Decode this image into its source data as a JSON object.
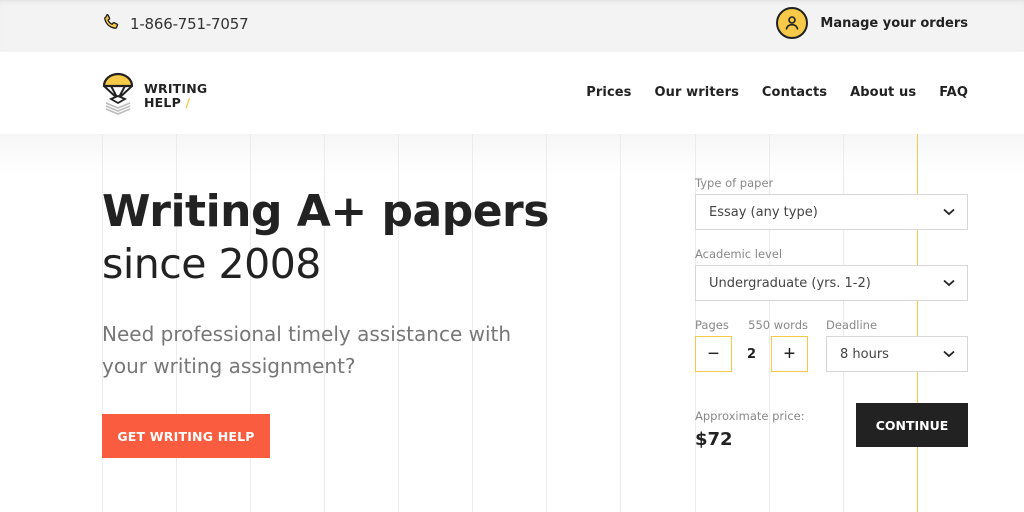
{
  "topbar": {
    "phone_icon": "phone-icon",
    "phone_number": "1-866-751-7057",
    "account_icon": "user-icon",
    "manage_orders": "Manage your orders"
  },
  "brand": {
    "line1": "WRITING",
    "line2": "HELP",
    "slash": "/",
    "logo_icon": "parachute-icon",
    "accent_color": "#f7c948"
  },
  "nav": {
    "items": [
      {
        "label": "Prices"
      },
      {
        "label": "Our writers"
      },
      {
        "label": "Contacts"
      },
      {
        "label": "About us"
      },
      {
        "label": "FAQ"
      }
    ]
  },
  "hero": {
    "headline": "Writing A+ papers",
    "subhead": "since 2008",
    "lede": "Need professional timely assistance with your writing assignment?",
    "cta_label": "GET WRITING HELP",
    "cta_color": "#fa5c3f"
  },
  "order_form": {
    "type_of_paper": {
      "label": "Type of paper",
      "value": "Essay (any type)"
    },
    "academic_level": {
      "label": "Academic level",
      "value": "Undergraduate (yrs. 1-2)"
    },
    "pages": {
      "label": "Pages",
      "words": "550 words",
      "value": "2",
      "decrement": "−",
      "increment": "+"
    },
    "deadline": {
      "label": "Deadline",
      "value": "8 hours"
    },
    "price": {
      "label": "Approximate price:",
      "value": "$72"
    },
    "continue_label": "CONTINUE"
  }
}
